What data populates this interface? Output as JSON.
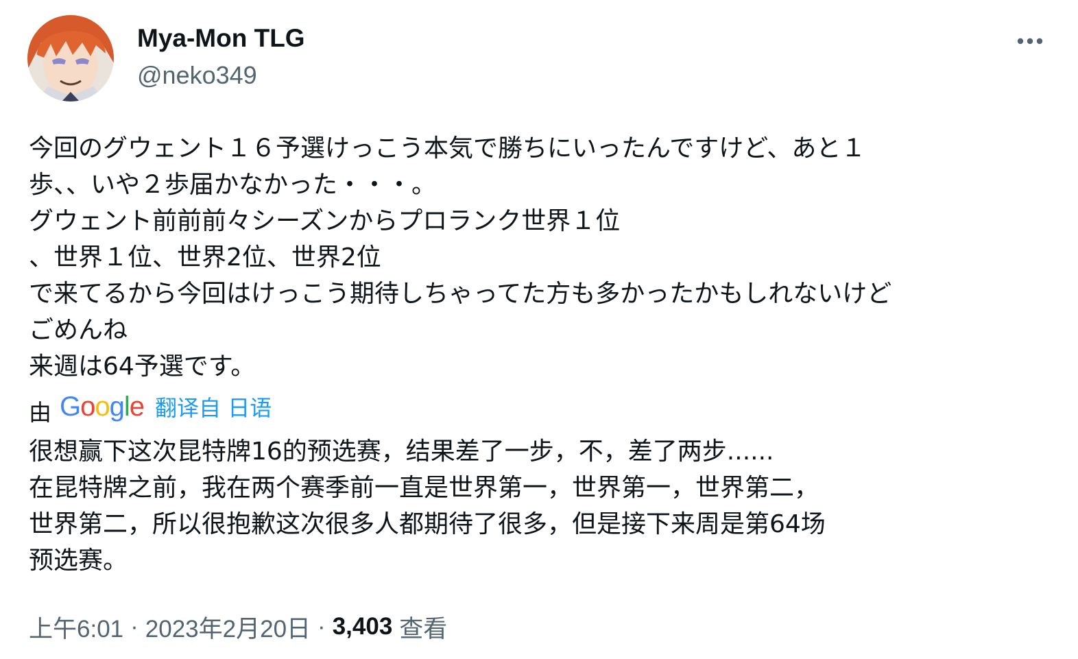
{
  "author": {
    "display_name": "Mya-Mon TLG",
    "handle": "@neko349"
  },
  "colors": {
    "text_primary": "#0f1419",
    "text_secondary": "#536471",
    "link": "#1d9bf0",
    "google_blue": "#4285f4",
    "google_red": "#ea4335",
    "google_yellow": "#fbbc05",
    "google_green": "#34a853"
  },
  "icons": {
    "more": "more-horizontal-icon",
    "avatar": "anime-avatar"
  },
  "tweet": {
    "original_text": "今回のグウェント１６予選けっこう本気で勝ちにいったんですけど、あと１\n歩、、いや２歩届かなかった・・・。\nグウェント前前前々シーズンからプロランク世界１位\n、世界１位、世界2位、世界2位\nで来てるから今回はけっこう期待しちゃってた方も多かったかもしれないけど\nごめんね\n来週は64予選です。",
    "translation": {
      "by_label": "由",
      "google_letters": [
        "G",
        "o",
        "o",
        "g",
        "l",
        "e"
      ],
      "link_label": "翻译自 日语"
    },
    "translated_text": "很想赢下这次昆特牌16的预选赛，结果差了一步，不，差了两步......\n在昆特牌之前，我在两个赛季前一直是世界第一，世界第一，世界第二，\n世界第二，所以很抱歉这次很多人都期待了很多，但是接下来周是第64场\n预选赛。",
    "meta": {
      "time": "上午6:01",
      "separator": "·",
      "date": "2023年2月20日",
      "views_count": "3,403",
      "views_label": "查看"
    }
  }
}
